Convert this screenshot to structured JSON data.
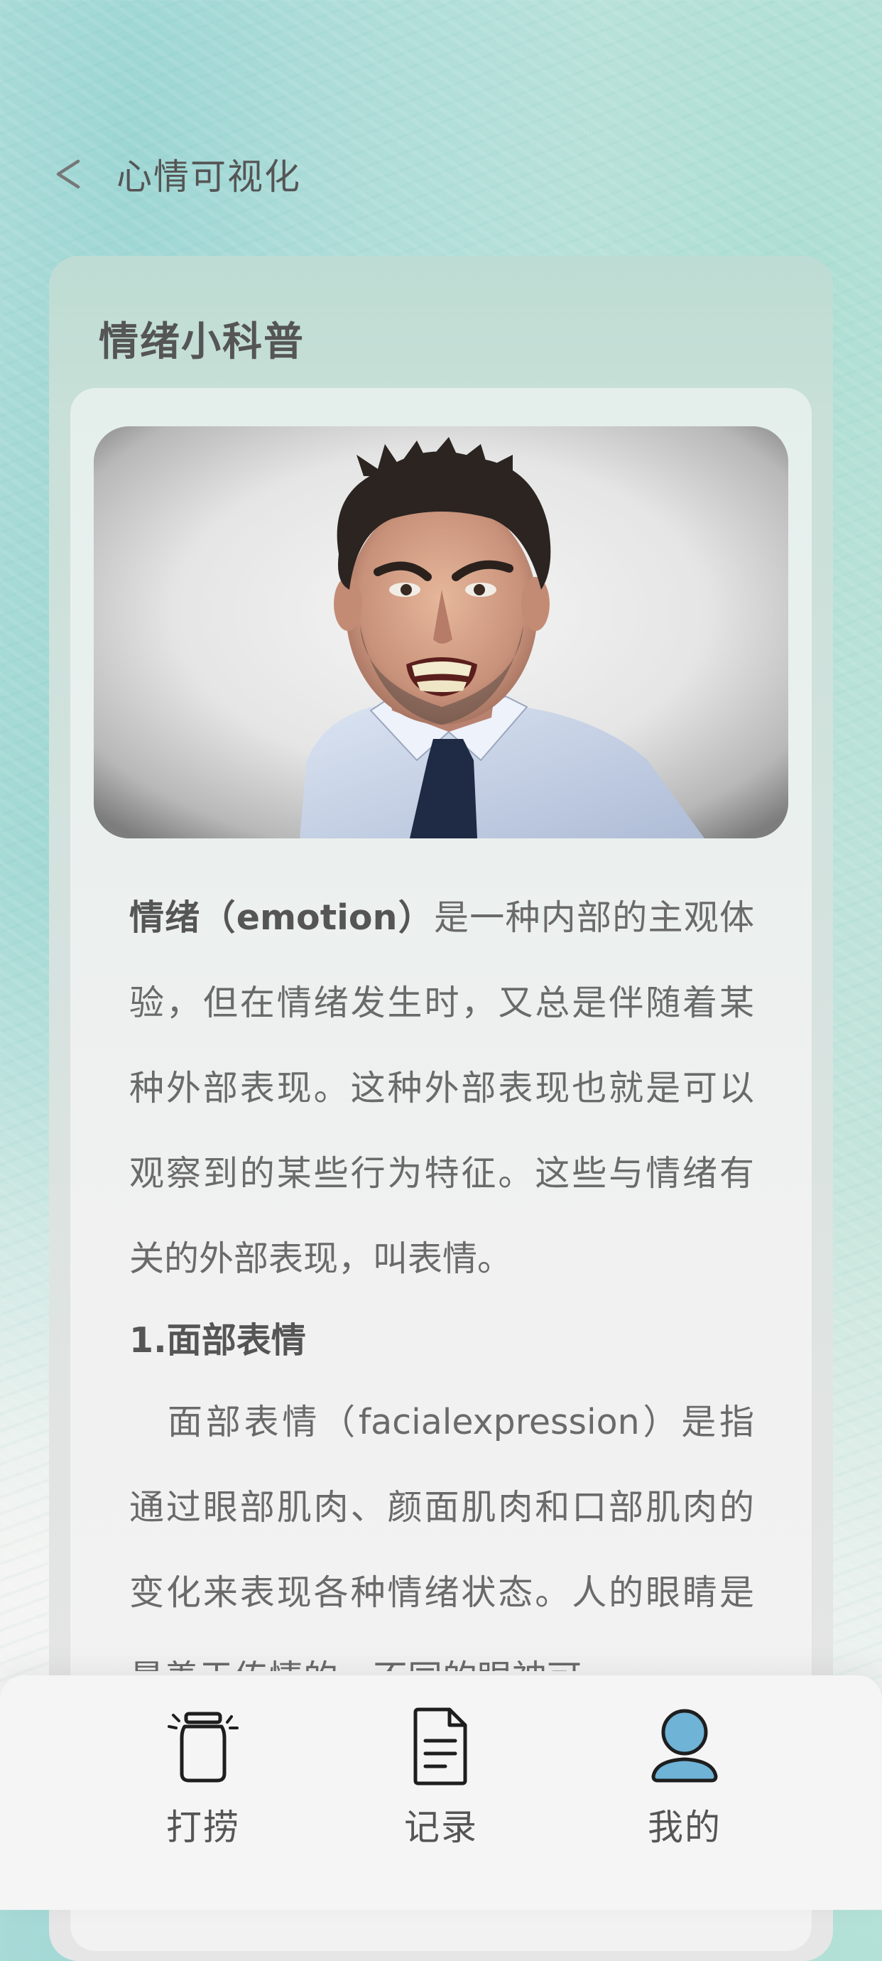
{
  "header": {
    "back_icon": "chevron-left-icon",
    "title": "心情可视化"
  },
  "card": {
    "title": "情绪小科普",
    "photo_icon": "angry-man-photo"
  },
  "article": {
    "intro_term": "情绪（emotion）",
    "intro_text": "是一种内部的主观体验，但在情绪发生时，又总是伴随着某种外部表现。这种外部表现也就是可以观察到的某些行为特征。这些与情绪有关的外部表现，叫表情。",
    "section1_title": "1.面部表情",
    "section1_text": "面部表情（facialexpression）是指通过眼部肌肉、颜面肌肉和口部肌肉的变化来表现各种情绪状态。人的眼睛是最善于传情的，不同的眼神可"
  },
  "tabbar": {
    "tabs": [
      {
        "label": "打捞",
        "icon": "jar-icon"
      },
      {
        "label": "记录",
        "icon": "document-icon"
      },
      {
        "label": "我的",
        "icon": "user-icon"
      }
    ]
  },
  "colors": {
    "text": "#555555",
    "body_text": "#6a6a6a",
    "user_icon_fill": "#6fb3d6"
  }
}
